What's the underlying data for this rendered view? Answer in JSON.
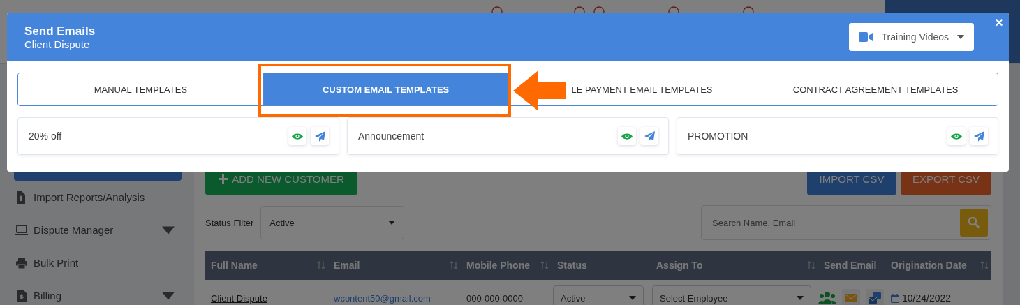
{
  "sidebar": {
    "items": [
      {
        "label": "Import Reports/Analysis",
        "expandable": false
      },
      {
        "label": "Dispute Manager",
        "expandable": true
      },
      {
        "label": "Bulk Print",
        "expandable": false
      },
      {
        "label": "Billing",
        "expandable": true
      }
    ]
  },
  "toolbar": {
    "add_button": "ADD NEW CUSTOMER",
    "import_button": "IMPORT CSV",
    "export_button": "EXPORT CSV"
  },
  "filter": {
    "label": "Status Filter",
    "value": "Active"
  },
  "search": {
    "placeholder": "Search Name, Email"
  },
  "table": {
    "columns": [
      {
        "label": "Full Name",
        "sortable": true
      },
      {
        "label": "Email",
        "sortable": true
      },
      {
        "label": "Mobile Phone",
        "sortable": true
      },
      {
        "label": "Status",
        "sortable": false
      },
      {
        "label": "Assign To",
        "sortable": true
      },
      {
        "label": "Send Email",
        "sortable": false
      },
      {
        "label": "Origination Date",
        "sortable": true
      }
    ],
    "rows": [
      {
        "full_name": "Client Dispute",
        "email": "wcontent50@gmail.com",
        "mobile_phone": "000-000-0000",
        "status": "Active",
        "assign_to": "Select Employee",
        "origination_date": "10/24/2022"
      }
    ]
  },
  "modal": {
    "title": "Send Emails",
    "subtitle": "Client Dispute",
    "training_button": "Training Videos",
    "close": "×",
    "tabs": [
      {
        "label": "MANUAL TEMPLATES",
        "selected": false
      },
      {
        "label": "CUSTOM EMAIL TEMPLATES",
        "selected": true
      },
      {
        "label": "LE PAYMENT EMAIL TEMPLATES",
        "selected": false
      },
      {
        "label": "CONTRACT AGREEMENT TEMPLATES",
        "selected": false
      }
    ],
    "templates": [
      {
        "name": "20% off"
      },
      {
        "name": "Announcement"
      },
      {
        "name": "PROMOTION"
      }
    ]
  }
}
